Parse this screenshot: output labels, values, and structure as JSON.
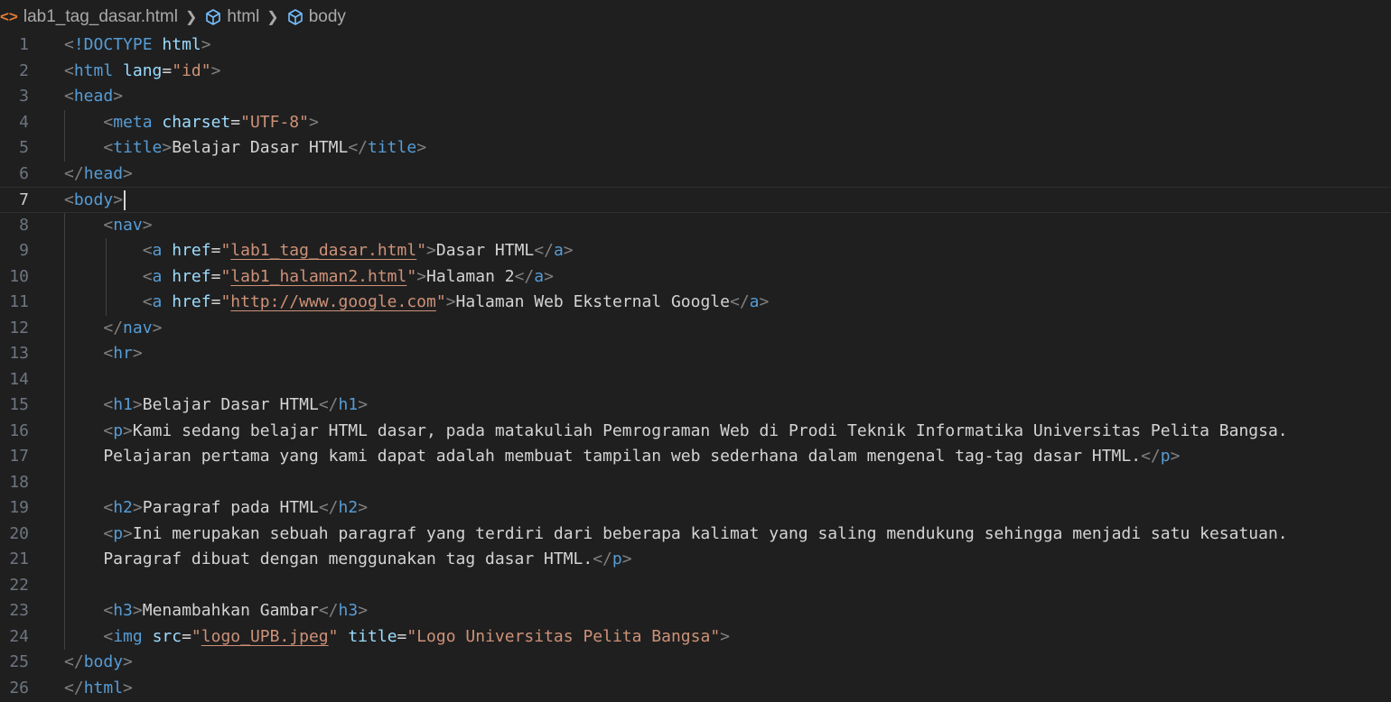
{
  "breadcrumb": {
    "file_icon": "<>",
    "file": "lab1_tag_dasar.html",
    "items": [
      "html",
      "body"
    ]
  },
  "colors": {
    "background": "#1f1f1f",
    "tag": "#569cd6",
    "attribute": "#9cdcfe",
    "string": "#ce9178",
    "text": "#d4d4d4",
    "bracket": "#808080",
    "html_icon": "#e37933"
  },
  "editor": {
    "current_line": 7,
    "lines": [
      [
        [
          "b",
          "<"
        ],
        [
          "tag",
          "!DOCTYPE"
        ],
        [
          "txt",
          " "
        ],
        [
          "attr",
          "html"
        ],
        [
          "b",
          ">"
        ]
      ],
      [
        [
          "b",
          "<"
        ],
        [
          "tag",
          "html"
        ],
        [
          "txt",
          " "
        ],
        [
          "attr",
          "lang"
        ],
        [
          "txt",
          "="
        ],
        [
          "str",
          "\"id\""
        ],
        [
          "b",
          ">"
        ]
      ],
      [
        [
          "b",
          "<"
        ],
        [
          "tag",
          "head"
        ],
        [
          "b",
          ">"
        ]
      ],
      [
        [
          "txt",
          "    "
        ],
        [
          "b",
          "<"
        ],
        [
          "tag",
          "meta"
        ],
        [
          "txt",
          " "
        ],
        [
          "attr",
          "charset"
        ],
        [
          "txt",
          "="
        ],
        [
          "str",
          "\"UTF-8\""
        ],
        [
          "b",
          ">"
        ]
      ],
      [
        [
          "txt",
          "    "
        ],
        [
          "b",
          "<"
        ],
        [
          "tag",
          "title"
        ],
        [
          "b",
          ">"
        ],
        [
          "txt",
          "Belajar Dasar HTML"
        ],
        [
          "b",
          "</"
        ],
        [
          "tag",
          "title"
        ],
        [
          "b",
          ">"
        ]
      ],
      [
        [
          "b",
          "</"
        ],
        [
          "tag",
          "head"
        ],
        [
          "b",
          ">"
        ]
      ],
      [
        [
          "b",
          "<"
        ],
        [
          "tag",
          "body"
        ],
        [
          "b",
          ">"
        ]
      ],
      [
        [
          "txt",
          "    "
        ],
        [
          "b",
          "<"
        ],
        [
          "tag",
          "nav"
        ],
        [
          "b",
          ">"
        ]
      ],
      [
        [
          "txt",
          "        "
        ],
        [
          "b",
          "<"
        ],
        [
          "tag",
          "a"
        ],
        [
          "txt",
          " "
        ],
        [
          "attr",
          "href"
        ],
        [
          "txt",
          "="
        ],
        [
          "str",
          "\""
        ],
        [
          "link",
          "lab1_tag_dasar.html"
        ],
        [
          "str",
          "\""
        ],
        [
          "b",
          ">"
        ],
        [
          "txt",
          "Dasar HTML"
        ],
        [
          "b",
          "</"
        ],
        [
          "tag",
          "a"
        ],
        [
          "b",
          ">"
        ]
      ],
      [
        [
          "txt",
          "        "
        ],
        [
          "b",
          "<"
        ],
        [
          "tag",
          "a"
        ],
        [
          "txt",
          " "
        ],
        [
          "attr",
          "href"
        ],
        [
          "txt",
          "="
        ],
        [
          "str",
          "\""
        ],
        [
          "link",
          "lab1_halaman2.html"
        ],
        [
          "str",
          "\""
        ],
        [
          "b",
          ">"
        ],
        [
          "txt",
          "Halaman 2"
        ],
        [
          "b",
          "</"
        ],
        [
          "tag",
          "a"
        ],
        [
          "b",
          ">"
        ]
      ],
      [
        [
          "txt",
          "        "
        ],
        [
          "b",
          "<"
        ],
        [
          "tag",
          "a"
        ],
        [
          "txt",
          " "
        ],
        [
          "attr",
          "href"
        ],
        [
          "txt",
          "="
        ],
        [
          "str",
          "\""
        ],
        [
          "link",
          "http://www.google.com"
        ],
        [
          "str",
          "\""
        ],
        [
          "b",
          ">"
        ],
        [
          "txt",
          "Halaman Web Eksternal Google"
        ],
        [
          "b",
          "</"
        ],
        [
          "tag",
          "a"
        ],
        [
          "b",
          ">"
        ]
      ],
      [
        [
          "txt",
          "    "
        ],
        [
          "b",
          "</"
        ],
        [
          "tag",
          "nav"
        ],
        [
          "b",
          ">"
        ]
      ],
      [
        [
          "txt",
          "    "
        ],
        [
          "b",
          "<"
        ],
        [
          "tag",
          "hr"
        ],
        [
          "b",
          ">"
        ]
      ],
      [],
      [
        [
          "txt",
          "    "
        ],
        [
          "b",
          "<"
        ],
        [
          "tag",
          "h1"
        ],
        [
          "b",
          ">"
        ],
        [
          "txt",
          "Belajar Dasar HTML"
        ],
        [
          "b",
          "</"
        ],
        [
          "tag",
          "h1"
        ],
        [
          "b",
          ">"
        ]
      ],
      [
        [
          "txt",
          "    "
        ],
        [
          "b",
          "<"
        ],
        [
          "tag",
          "p"
        ],
        [
          "b",
          ">"
        ],
        [
          "txt",
          "Kami sedang belajar HTML dasar, pada matakuliah Pemrograman Web di Prodi Teknik Informatika Universitas Pelita Bangsa."
        ]
      ],
      [
        [
          "txt",
          "    Pelajaran pertama yang kami dapat adalah membuat tampilan web sederhana dalam mengenal tag-tag dasar HTML."
        ],
        [
          "b",
          "</"
        ],
        [
          "tag",
          "p"
        ],
        [
          "b",
          ">"
        ]
      ],
      [],
      [
        [
          "txt",
          "    "
        ],
        [
          "b",
          "<"
        ],
        [
          "tag",
          "h2"
        ],
        [
          "b",
          ">"
        ],
        [
          "txt",
          "Paragraf pada HTML"
        ],
        [
          "b",
          "</"
        ],
        [
          "tag",
          "h2"
        ],
        [
          "b",
          ">"
        ]
      ],
      [
        [
          "txt",
          "    "
        ],
        [
          "b",
          "<"
        ],
        [
          "tag",
          "p"
        ],
        [
          "b",
          ">"
        ],
        [
          "txt",
          "Ini merupakan sebuah paragraf yang terdiri dari beberapa kalimat yang saling mendukung sehingga menjadi satu kesatuan."
        ]
      ],
      [
        [
          "txt",
          "    Paragraf dibuat dengan menggunakan tag dasar HTML."
        ],
        [
          "b",
          "</"
        ],
        [
          "tag",
          "p"
        ],
        [
          "b",
          ">"
        ]
      ],
      [],
      [
        [
          "txt",
          "    "
        ],
        [
          "b",
          "<"
        ],
        [
          "tag",
          "h3"
        ],
        [
          "b",
          ">"
        ],
        [
          "txt",
          "Menambahkan Gambar"
        ],
        [
          "b",
          "</"
        ],
        [
          "tag",
          "h3"
        ],
        [
          "b",
          ">"
        ]
      ],
      [
        [
          "txt",
          "    "
        ],
        [
          "b",
          "<"
        ],
        [
          "tag",
          "img"
        ],
        [
          "txt",
          " "
        ],
        [
          "attr",
          "src"
        ],
        [
          "txt",
          "="
        ],
        [
          "str",
          "\""
        ],
        [
          "link",
          "logo_UPB.jpeg"
        ],
        [
          "str",
          "\""
        ],
        [
          "txt",
          " "
        ],
        [
          "attr",
          "title"
        ],
        [
          "txt",
          "="
        ],
        [
          "str",
          "\"Logo Universitas Pelita Bangsa\""
        ],
        [
          "b",
          ">"
        ]
      ],
      [
        [
          "b",
          "</"
        ],
        [
          "tag",
          "body"
        ],
        [
          "b",
          ">"
        ]
      ],
      [
        [
          "b",
          "</"
        ],
        [
          "tag",
          "html"
        ],
        [
          "b",
          ">"
        ]
      ]
    ]
  }
}
